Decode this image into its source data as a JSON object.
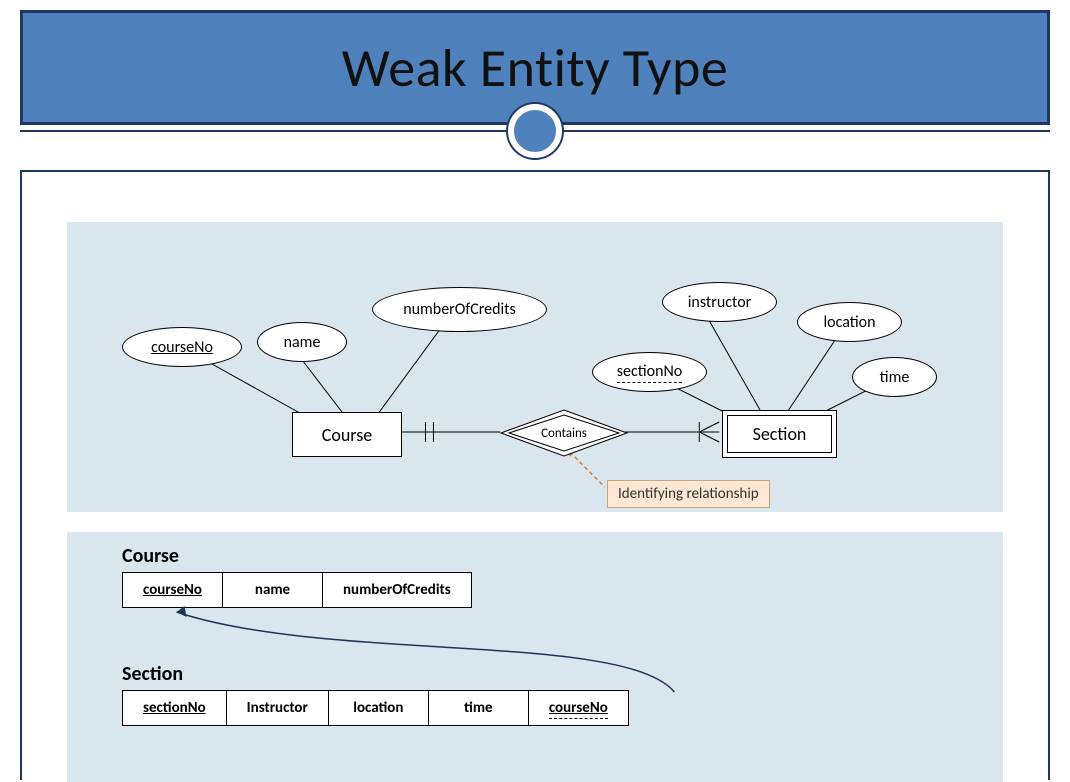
{
  "title": "Weak Entity Type",
  "er": {
    "entities": {
      "course": "Course",
      "section": "Section"
    },
    "relationship": "Contains",
    "attributes": {
      "courseNo": "courseNo",
      "name": "name",
      "numberOfCredits": "numberOfCredits",
      "sectionNo": "sectionNo",
      "instructor": "instructor",
      "location": "location",
      "time": "time"
    },
    "callout": "Identifying relationship"
  },
  "relational": {
    "course": {
      "title": "Course",
      "cols": [
        "courseNo",
        "name",
        "numberOfCredits"
      ]
    },
    "section": {
      "title": "Section",
      "cols": [
        "sectionNo",
        "Instructor",
        "location",
        "time",
        "courseNo"
      ]
    }
  }
}
